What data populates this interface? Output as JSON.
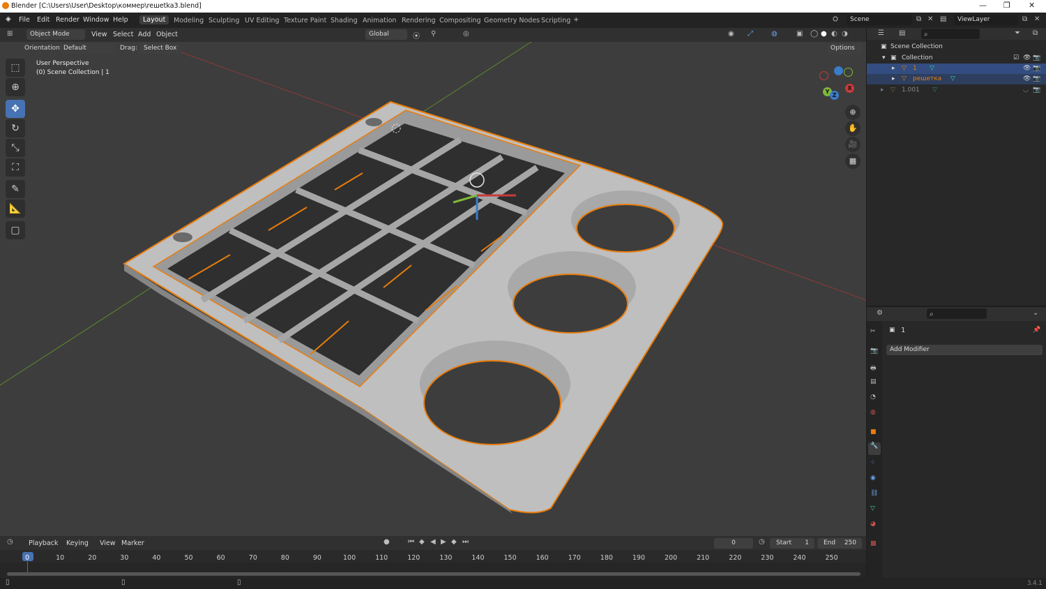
{
  "window": {
    "title": "Blender [C:\\Users\\User\\Desktop\\коммер\\reшetka3.blend]"
  },
  "menu": [
    "File",
    "Edit",
    "Render",
    "Window",
    "Help"
  ],
  "workspaces": [
    "Layout",
    "Modeling",
    "Sculpting",
    "UV Editing",
    "Texture Paint",
    "Shading",
    "Animation",
    "Rendering",
    "Compositing",
    "Geometry Nodes",
    "Scripting"
  ],
  "active_workspace": "Layout",
  "scene": {
    "label": "Scene",
    "view_layer": "ViewLayer"
  },
  "viewport_header": {
    "mode": "Object Mode",
    "menus": [
      "View",
      "Select",
      "Add",
      "Object"
    ],
    "transform_orientation": "Global",
    "orientation_label": "Orientation:",
    "orientation_value": "Default",
    "drag_label": "Drag:",
    "drag_value": "Select Box",
    "options": "Options"
  },
  "viewport_info": {
    "line1": "User Perspective",
    "line2": "(0) Scene Collection | 1"
  },
  "gizmo": {
    "x": "X",
    "y": "Y",
    "z": "Z"
  },
  "outliner": {
    "root": "Scene Collection",
    "collection": "Collection",
    "items": [
      {
        "name": "1",
        "selected": true
      },
      {
        "name": "решетка",
        "selected": true
      },
      {
        "name": "1.001",
        "selected": false
      }
    ]
  },
  "properties": {
    "object_name": "1",
    "add_modifier": "Add Modifier"
  },
  "timeline": {
    "menus": [
      "Playback",
      "Keying",
      "View",
      "Marker"
    ],
    "current_frame": "0",
    "start_label": "Start",
    "start": "1",
    "end_label": "End",
    "end": "250",
    "ruler": [
      "0",
      "10",
      "20",
      "30",
      "40",
      "50",
      "60",
      "70",
      "80",
      "90",
      "100",
      "110",
      "120",
      "130",
      "140",
      "150",
      "160",
      "170",
      "180",
      "190",
      "200",
      "210",
      "220",
      "230",
      "240",
      "250"
    ]
  },
  "status": {
    "version": "3.4.1"
  },
  "colors": {
    "accent": "#4772b3",
    "selection": "#e87d0d",
    "x_axis": "#c83a3a",
    "y_axis": "#7fb83a",
    "z_axis": "#3a7cc8"
  }
}
